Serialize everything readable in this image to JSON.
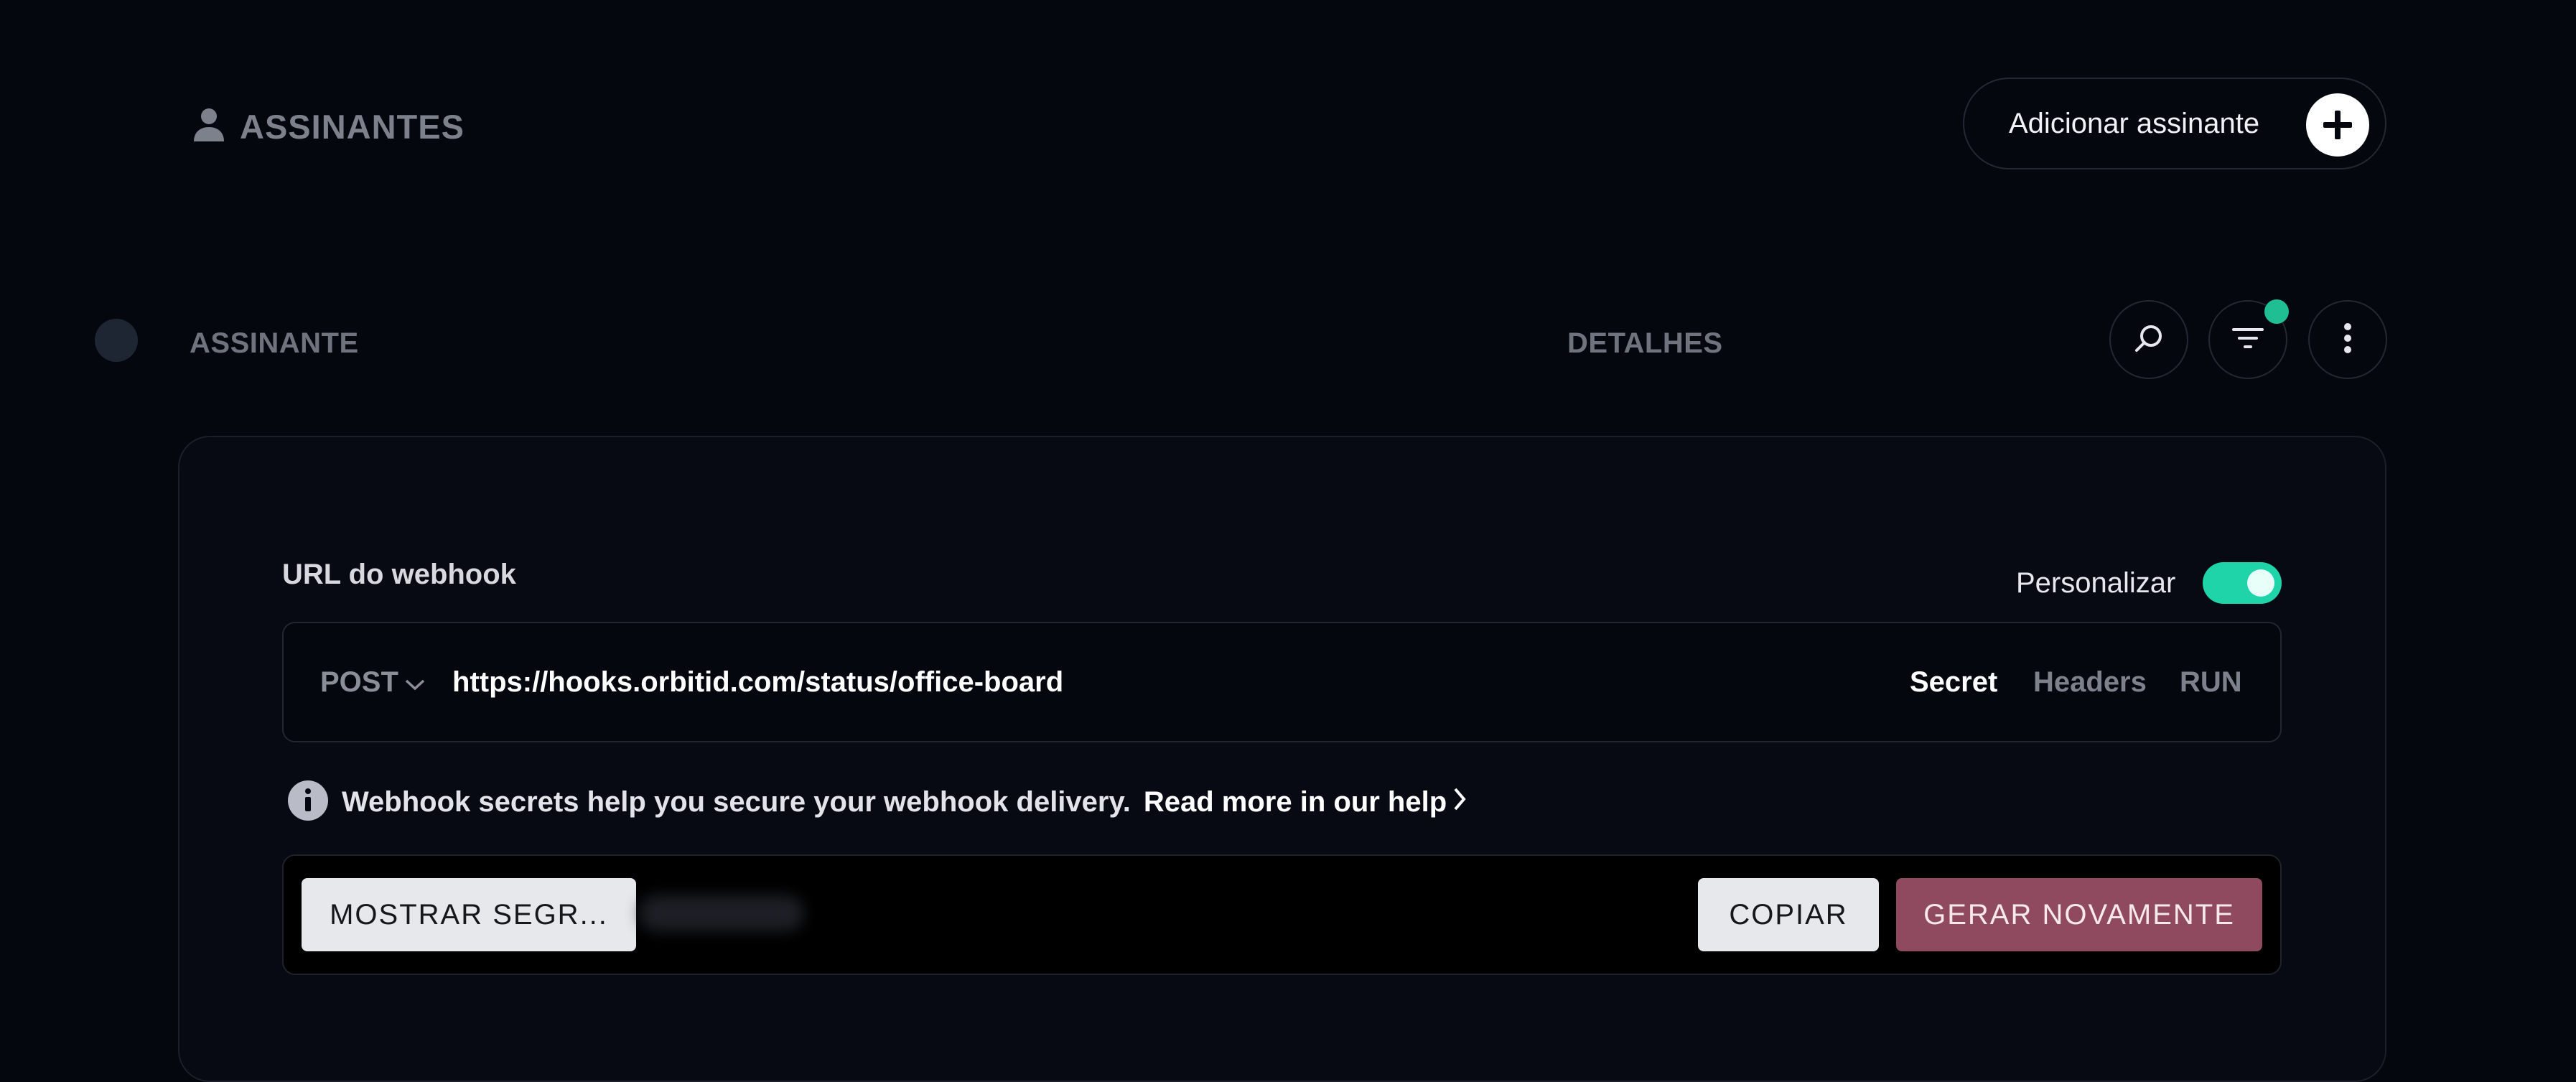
{
  "header": {
    "title": "ASSINANTES",
    "add_button_label": "Adicionar assinante"
  },
  "columns": {
    "subscriber": "ASSINANTE",
    "details": "DETALHES"
  },
  "webhook": {
    "label": "URL do webhook",
    "customize_label": "Personalizar",
    "customize_enabled": true,
    "method": "POST",
    "url": "https://hooks.orbitid.com/status/office-board",
    "tabs": [
      "Secret",
      "Headers",
      "RUN"
    ],
    "active_tab": "Secret",
    "info_text": "Webhook secrets help you secure your webhook delivery.",
    "info_link": "Read more in our help",
    "show_secret_label": "MOSTRAR SEGR...",
    "copy_label": "COPIAR",
    "regenerate_label": "GERAR NOVAMENTE"
  },
  "colors": {
    "background": "#05070f",
    "accent_green": "#1fd4a8",
    "filter_badge": "#1fbf93",
    "regenerate": "#8f4a5f"
  },
  "icons": {
    "title": "user-icon",
    "add": "plus-icon",
    "search": "search-icon",
    "filter": "filter-icon",
    "more": "more-vertical-icon",
    "method": "chevron-down-icon",
    "info": "info-icon",
    "link": "chevron-right-icon"
  }
}
